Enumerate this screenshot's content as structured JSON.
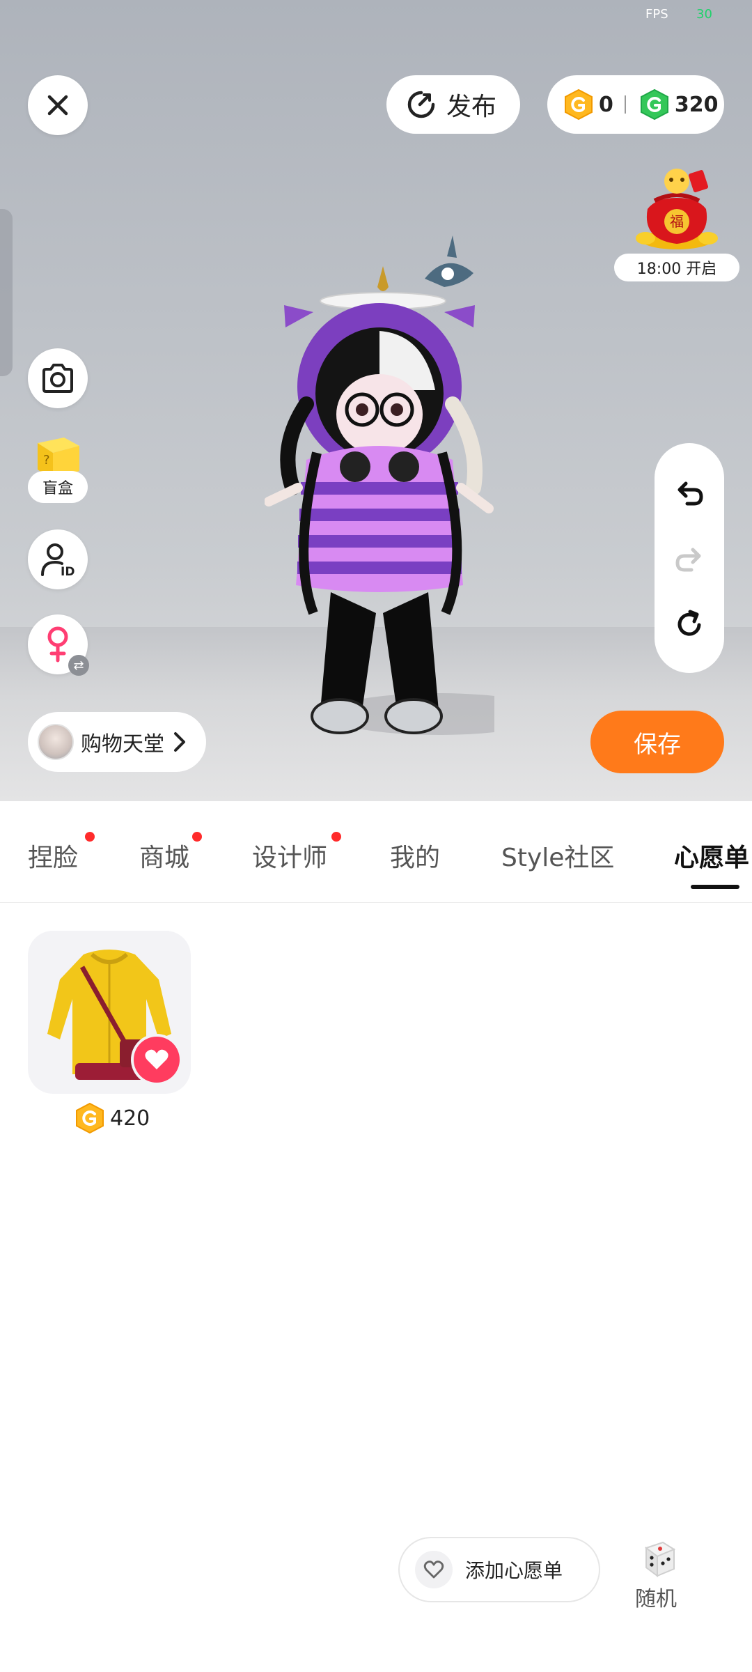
{
  "hud": {
    "fps_label": "FPS",
    "fps_value": "30"
  },
  "header": {
    "publish_label": "发布",
    "currency": {
      "gold_amount": "0",
      "green_amount": "320"
    },
    "event_time": "18:00 开启"
  },
  "left_tools": {
    "blind_box_label": "盲盒",
    "shop_label": "购物天堂"
  },
  "actions": {
    "save_label": "保存"
  },
  "tabs": [
    {
      "label": "捏脸",
      "has_dot": true
    },
    {
      "label": "商城",
      "has_dot": true
    },
    {
      "label": "设计师",
      "has_dot": true
    },
    {
      "label": "我的",
      "has_dot": false
    },
    {
      "label": "Style社区",
      "has_dot": false
    },
    {
      "label": "心愿单",
      "has_dot": false,
      "active": true
    }
  ],
  "wishlist": {
    "items": [
      {
        "name": "yellow-raincoat-outfit",
        "price": "420",
        "favorited": true
      }
    ]
  },
  "bottom": {
    "add_wishlist_label": "添加心愿单",
    "random_label": "随机"
  },
  "colors": {
    "accent": "#ff7a1a",
    "badge": "#ff3c5f",
    "tab_dot": "#ff2b2b",
    "coin_gold": "#ffb81f",
    "coin_green": "#34c759"
  },
  "icons": [
    "close-icon",
    "publish-icon",
    "gold-coin-icon",
    "green-coin-icon",
    "camera-icon",
    "blind-box-icon",
    "id-profile-icon",
    "female-icon",
    "swap-icon",
    "undo-icon",
    "redo-icon",
    "reset-icon",
    "chevron-right-icon",
    "heart-icon",
    "dice-icon"
  ]
}
